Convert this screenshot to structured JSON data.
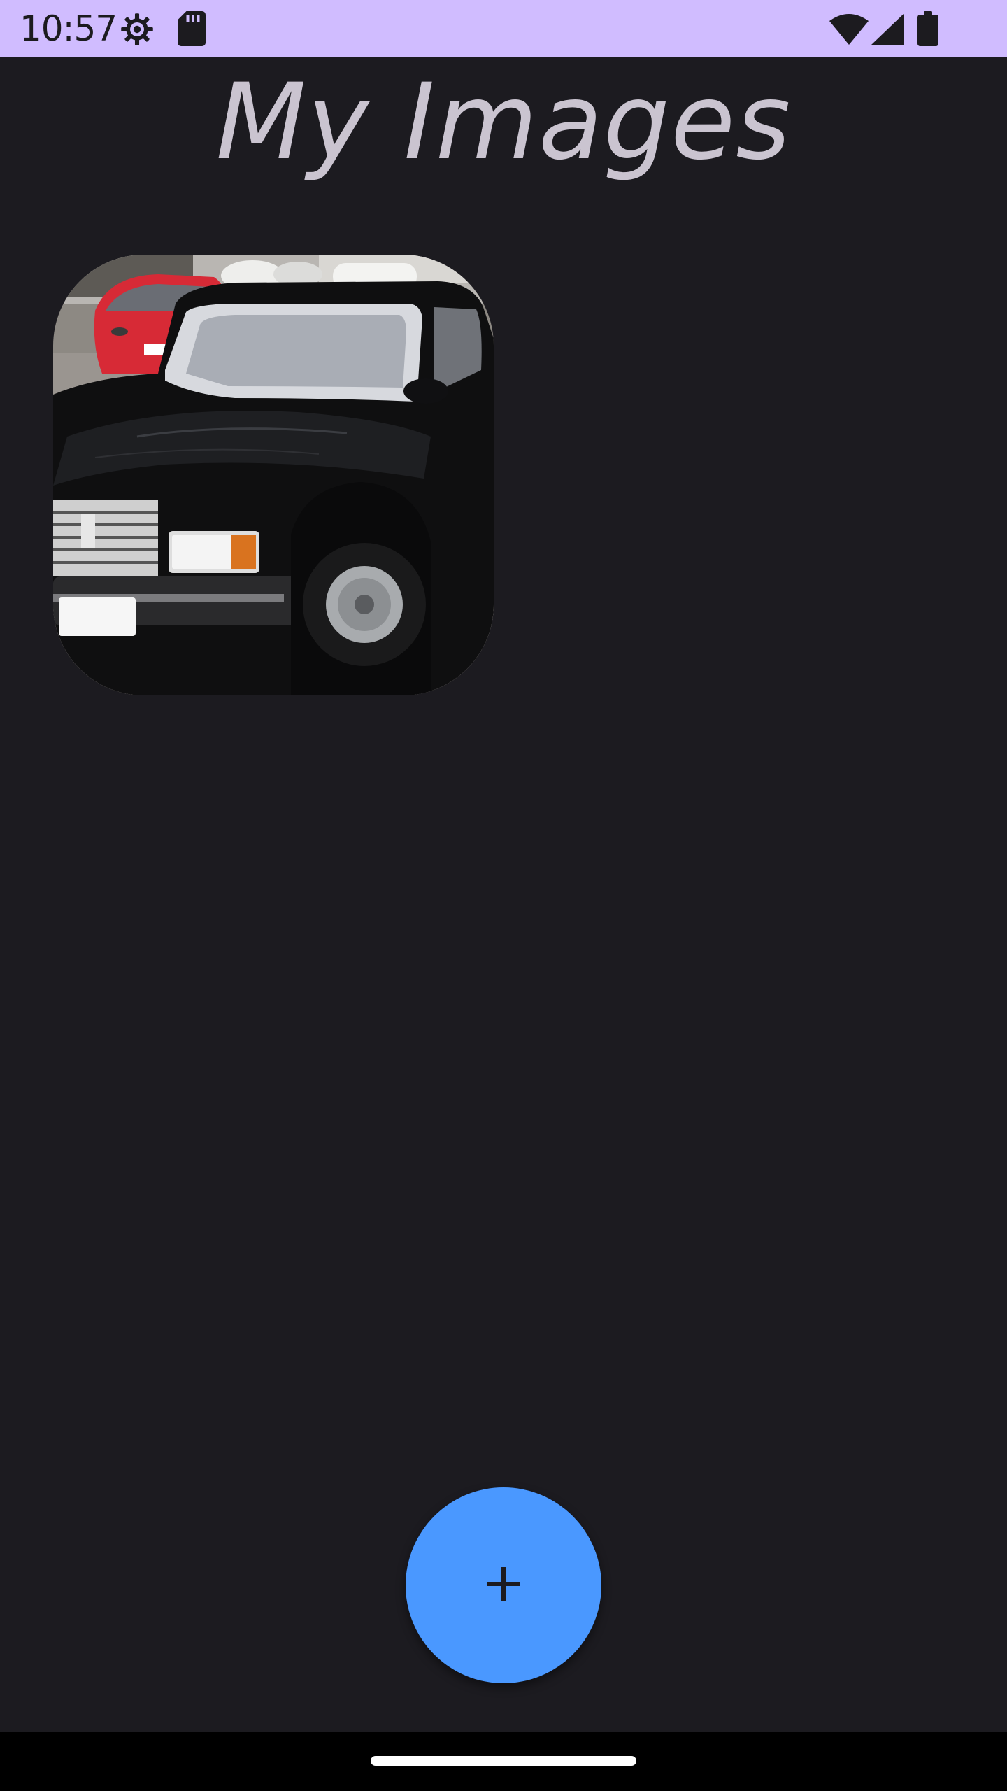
{
  "status_bar": {
    "time": "10:57",
    "background_color": "#d0bcff",
    "icons_left": [
      "settings-gear-icon",
      "sd-card-icon"
    ],
    "icons_right": [
      "wifi-icon",
      "cell-signal-icon",
      "battery-icon"
    ]
  },
  "header": {
    "title": "My Images"
  },
  "gallery": {
    "items": [
      {
        "icon": "car-photo"
      }
    ]
  },
  "fab": {
    "icon": "plus-icon",
    "color": "#4a98ff"
  },
  "theme": {
    "background": "#1c1b20",
    "title_color": "#cac4d0"
  }
}
